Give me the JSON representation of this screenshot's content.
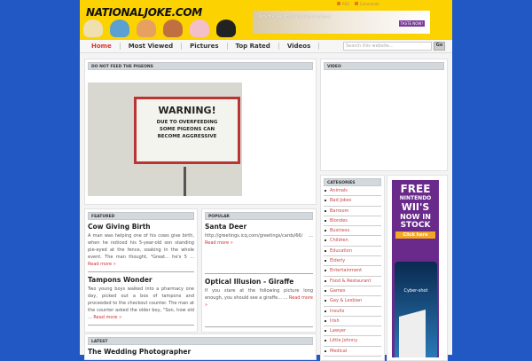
{
  "header": {
    "logo": "NATIONALJOKE.COM",
    "rss": "RSS",
    "comments": "Comments",
    "banner_text": "Taste the Delights: Gado-Gado in Jakarta",
    "banner_button": "TASTE NOW!"
  },
  "nav": {
    "items": [
      "Home",
      "Most Viewed",
      "Pictures",
      "Top Rated",
      "Videos"
    ],
    "search_placeholder": "Search this website...",
    "go": "Go"
  },
  "top_box": {
    "heading": "Do not feed the pigeons",
    "sign": [
      "WARNING!",
      "DUE TO OVERFEEDING",
      "SOME PIGEONS CAN",
      "BECOME AGGRESSIVE"
    ]
  },
  "video": {
    "heading": "Video"
  },
  "featured": {
    "heading": "Featured",
    "posts": [
      {
        "title": "Cow Giving Birth",
        "excerpt": "A man was helping one of his cows give birth, when he noticed his 5-year-old son standing pie-eyed at the fence, soaking in the whole event. The man thought, \"Great... he's 5 ...",
        "more": "Read more »"
      },
      {
        "title": "Tampons Wonder",
        "excerpt": "Two young boys walked into a pharmacy one day, picked out a box of tampons and proceeded to the checkout counter. The man at the counter asked the older boy, \"Son, how old ...",
        "more": "Read more »"
      }
    ]
  },
  "popular": {
    "heading": "Popular",
    "posts": [
      {
        "title": "Santa Deer",
        "excerpt": "http://greetings.icq.com/greetings/cards/66/ ...",
        "more": "Read more »"
      },
      {
        "title": "Optical Illusion - Giraffe",
        "excerpt": "If you stare at the following picture long enough, you should see a giraffe... ...",
        "more": "Read more »"
      }
    ]
  },
  "latest": {
    "heading": "Latest",
    "title": "The Wedding Photographer"
  },
  "categories": {
    "heading": "Categories",
    "items": [
      "Animals",
      "Bad Jokes",
      "Barroom",
      "Blondes",
      "Business",
      "Children",
      "Education",
      "Elderly",
      "Entertainment",
      "Food & Restaurant",
      "Games",
      "Gay & Lesbian",
      "Insults",
      "Irish",
      "Lawyer",
      "Little Johnny",
      "Medical"
    ]
  },
  "ad": {
    "lines": [
      "FREE",
      "NINTENDO",
      "WII'S",
      "NOW IN",
      "STOCK"
    ],
    "button": "Click here",
    "brand": "Cyber-shot"
  }
}
